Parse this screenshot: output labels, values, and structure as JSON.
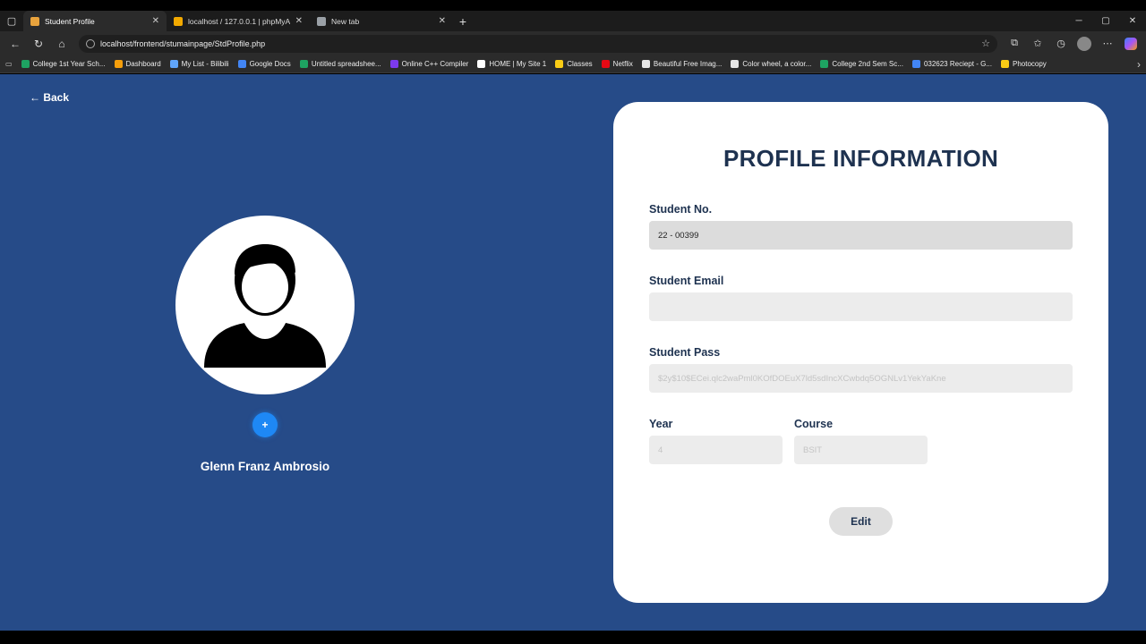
{
  "browser": {
    "tabs": [
      {
        "title": "Student Profile",
        "color": "#e8a33d",
        "active": true
      },
      {
        "title": "localhost / 127.0.0.1 | phpMyAdmin",
        "color": "#f2a900",
        "active": false
      },
      {
        "title": "New tab",
        "color": "#9aa0a6",
        "active": false
      }
    ],
    "url": "localhost/frontend/stumainpage/StdProfile.php",
    "bookmarks": [
      {
        "label": "College 1st Year Sch...",
        "color": "#1ea362"
      },
      {
        "label": "Dashboard",
        "color": "#f59e0b"
      },
      {
        "label": "My List - Bilibili",
        "color": "#60a5fa"
      },
      {
        "label": "Google Docs",
        "color": "#4285f4"
      },
      {
        "label": "Untitled spreadshee...",
        "color": "#1ea362"
      },
      {
        "label": "Online C++ Compiler",
        "color": "#7c3aed"
      },
      {
        "label": "HOME | My Site 1",
        "color": "#ffffff"
      },
      {
        "label": "Classes",
        "color": "#facc15"
      },
      {
        "label": "Netflix",
        "color": "#e50914"
      },
      {
        "label": "Beautiful Free Imag...",
        "color": "#e5e5e5"
      },
      {
        "label": "Color wheel, a color...",
        "color": "#e5e5e5"
      },
      {
        "label": "College 2nd Sem Sc...",
        "color": "#1ea362"
      },
      {
        "label": "032623 Reciept - G...",
        "color": "#4285f4"
      },
      {
        "label": "Photocopy",
        "color": "#facc15"
      }
    ]
  },
  "page": {
    "back_label": "← Back",
    "add_photo_label": "+",
    "student_name": "Glenn Franz Ambrosio",
    "card": {
      "title": "PROFILE INFORMATION",
      "student_no_label": "Student No.",
      "student_no_value": "22 - 00399",
      "email_label": "Student Email",
      "email_value": "",
      "pass_label": "Student Pass",
      "pass_value": "$2y$10$ECei.qlc2waPml0KOfDOEuX7ld5sdIncXCwbdq5OGNLv1YekYaKne",
      "year_label": "Year",
      "year_value": "4",
      "course_label": "Course",
      "course_value": "BSIT",
      "edit_label": "Edit"
    }
  },
  "colors": {
    "page_bg": "#264b88",
    "title": "#1e3250",
    "add_button": "#1e88f5"
  }
}
